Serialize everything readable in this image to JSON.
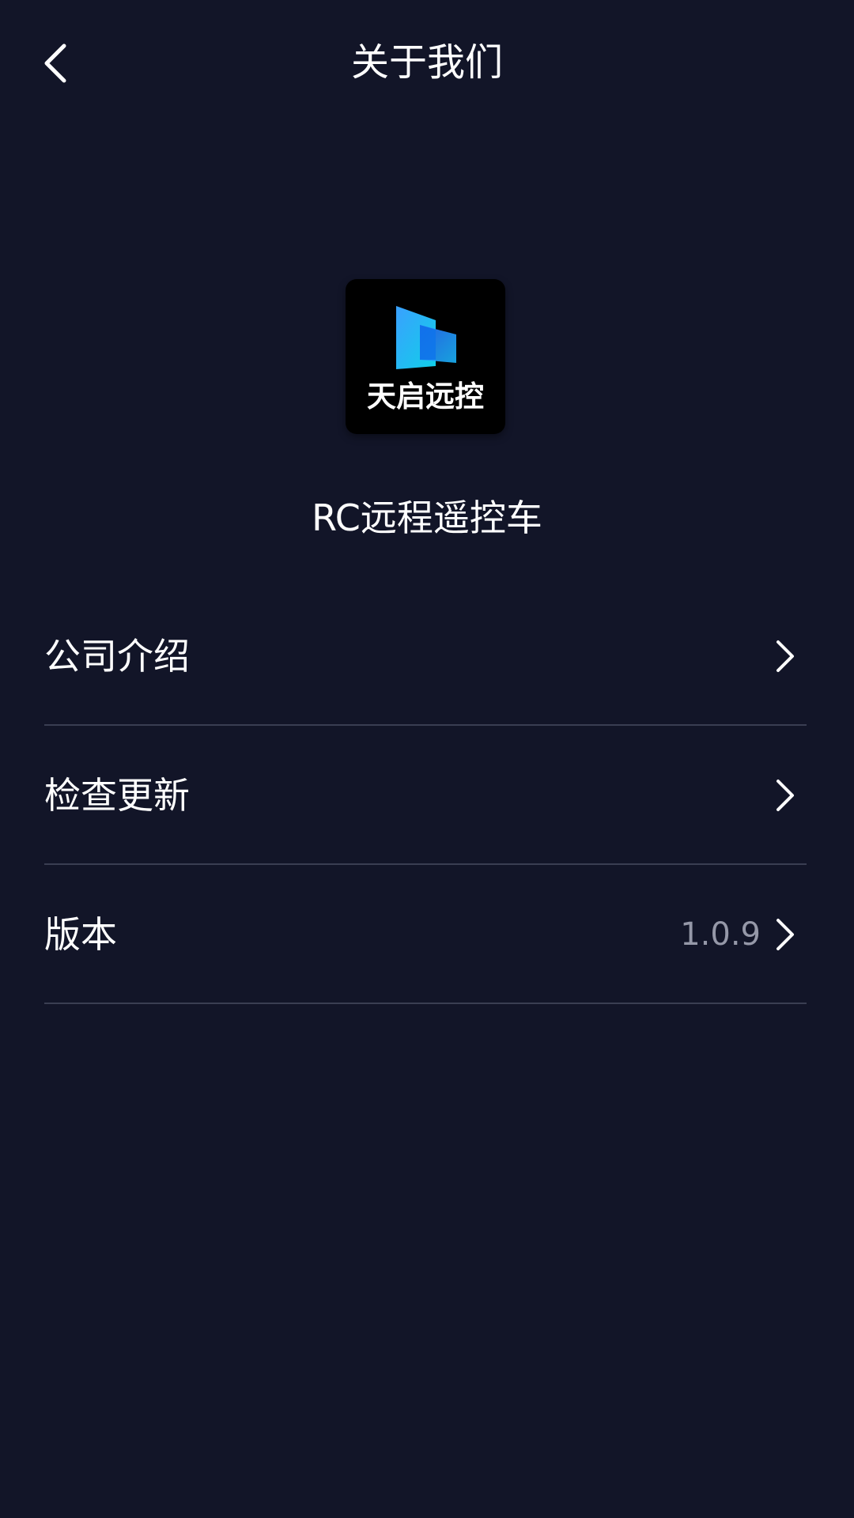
{
  "header": {
    "title": "关于我们",
    "back_icon": "chevron-left-icon"
  },
  "app": {
    "logo_text": "天启远控",
    "name": "RC远程遥控车"
  },
  "menu": {
    "items": [
      {
        "label": "公司介绍",
        "value": "",
        "icon": "chevron-right-icon"
      },
      {
        "label": "检查更新",
        "value": "",
        "icon": "chevron-right-icon"
      },
      {
        "label": "版本",
        "value": "1.0.9",
        "icon": "chevron-right-icon"
      }
    ]
  },
  "colors": {
    "background": "#121528",
    "divider": "#3a3e52",
    "secondary_text": "#9598a8",
    "logo_blue": "#1e9bf0"
  }
}
